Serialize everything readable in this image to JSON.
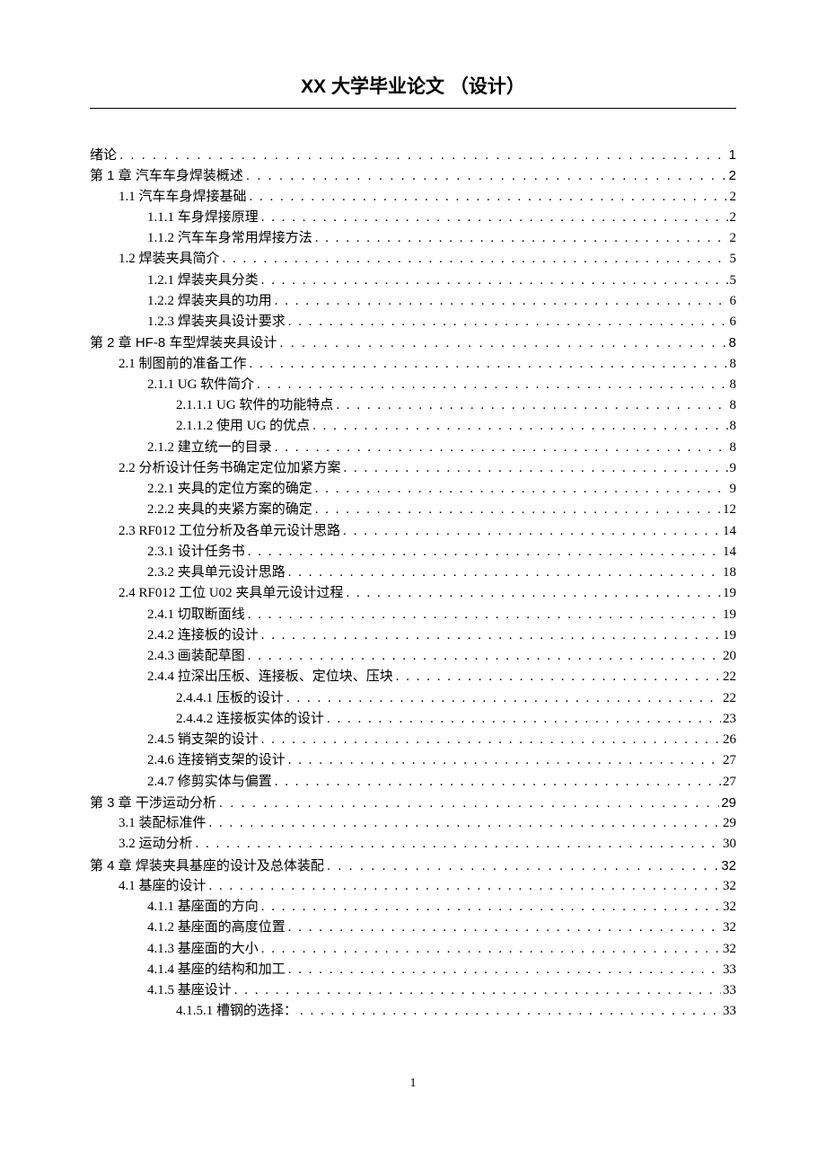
{
  "header": "XX 大学毕业论文 （设计）",
  "footer": "1",
  "toc": [
    {
      "level": 0,
      "label": "绪论",
      "page": "1",
      "chapter": true
    },
    {
      "level": 0,
      "label": "第 1 章  汽车车身焊装概述",
      "page": "2",
      "chapter": true
    },
    {
      "level": 1,
      "label": "1.1 汽车车身焊接基础",
      "page": "2"
    },
    {
      "level": 2,
      "label": "1.1.1 车身焊接原理",
      "page": "2"
    },
    {
      "level": 2,
      "label": "1.1.2 汽车车身常用焊接方法",
      "page": "2"
    },
    {
      "level": 1,
      "label": "1.2 焊装夹具简介",
      "page": "5"
    },
    {
      "level": 2,
      "label": "1.2.1 焊装夹具分类",
      "page": "5"
    },
    {
      "level": 2,
      "label": "1.2.2 焊装夹具的功用",
      "page": "6"
    },
    {
      "level": 2,
      "label": "1.2.3 焊装夹具设计要求",
      "page": "6"
    },
    {
      "level": 0,
      "label": "第 2 章  HF-8 车型焊装夹具设计",
      "page": "8",
      "chapter": true
    },
    {
      "level": 1,
      "label": "2.1 制图前的准备工作",
      "page": "8"
    },
    {
      "level": 2,
      "label": "2.1.1  UG 软件简介",
      "page": "8"
    },
    {
      "level": 3,
      "label": "2.1.1.1 UG 软件的功能特点",
      "page": "8"
    },
    {
      "level": 3,
      "label": "2.1.1.2 使用 UG 的优点",
      "page": "8"
    },
    {
      "level": 2,
      "label": "2.1.2 建立统一的目录",
      "page": "8"
    },
    {
      "level": 1,
      "label": "2.2 分析设计任务书确定定位加紧方案",
      "page": "9"
    },
    {
      "level": 2,
      "label": "2.2.1 夹具的定位方案的确定",
      "page": "9"
    },
    {
      "level": 2,
      "label": "2.2.2 夹具的夹紧方案的确定",
      "page": "12"
    },
    {
      "level": 1,
      "label": "2.3  RF012 工位分析及各单元设计思路",
      "page": "14"
    },
    {
      "level": 2,
      "label": "2.3.1 设计任务书",
      "page": "14"
    },
    {
      "level": 2,
      "label": "2.3.2 夹具单元设计思路",
      "page": "18"
    },
    {
      "level": 1,
      "label": "2.4  RF012 工位 U02 夹具单元设计过程",
      "page": "19"
    },
    {
      "level": 2,
      "label": "2.4.1 切取断面线",
      "page": "19"
    },
    {
      "level": 2,
      "label": "2.4.2 连接板的设计",
      "page": "19"
    },
    {
      "level": 2,
      "label": "2.4.3 画装配草图",
      "page": "20"
    },
    {
      "level": 2,
      "label": "2.4.4 拉深出压板、连接板、定位块、压块",
      "page": "22"
    },
    {
      "level": 3,
      "label": "2.4.4.1 压板的设计",
      "page": "22"
    },
    {
      "level": 3,
      "label": "2.4.4.2 连接板实体的设计",
      "page": "23"
    },
    {
      "level": 2,
      "label": "2.4.5 销支架的设计",
      "page": "26"
    },
    {
      "level": 2,
      "label": "2.4.6 连接销支架的设计",
      "page": "27"
    },
    {
      "level": 2,
      "label": "2.4.7 修剪实体与偏置",
      "page": "27"
    },
    {
      "level": 0,
      "label": "第 3 章   干涉运动分析",
      "page": "29",
      "chapter": true
    },
    {
      "level": 1,
      "label": "3.1 装配标准件",
      "page": "29"
    },
    {
      "level": 1,
      "label": "3.2 运动分析",
      "page": "30"
    },
    {
      "level": 0,
      "label": "第 4 章  焊装夹具基座的设计及总体装配",
      "page": "32",
      "chapter": true
    },
    {
      "level": 1,
      "label": "4.1 基座的设计",
      "page": "32"
    },
    {
      "level": 2,
      "label": "4.1.1   基座面的方向",
      "page": "32"
    },
    {
      "level": 2,
      "label": "4.1.2   基座面的高度位置",
      "page": "32"
    },
    {
      "level": 2,
      "label": "4.1.3   基座面的大小",
      "page": "32"
    },
    {
      "level": 2,
      "label": "4.1.4   基座的结构和加工",
      "page": "33"
    },
    {
      "level": 2,
      "label": "4.1.5   基座设计",
      "page": "33"
    },
    {
      "level": 3,
      "label": "4.1.5.1   槽钢的选择：",
      "page": "33"
    }
  ]
}
